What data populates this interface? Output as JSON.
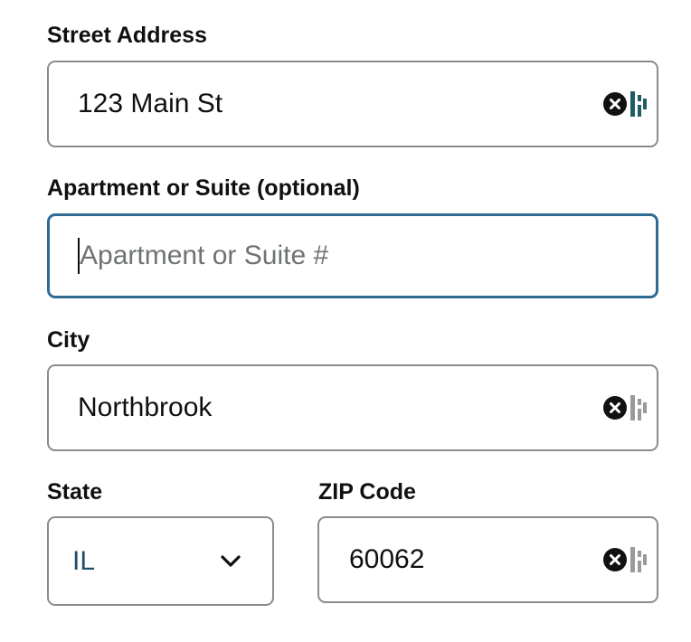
{
  "street": {
    "label": "Street Address",
    "value": "123 Main St",
    "clear_icon": "close-circle-icon",
    "autofill_icon": "password-manager-icon"
  },
  "apartment": {
    "label": "Apartment or Suite (optional)",
    "value": "",
    "placeholder": "Apartment or Suite #"
  },
  "city": {
    "label": "City",
    "value": "Northbrook",
    "clear_icon": "close-circle-icon",
    "autofill_icon": "password-manager-icon"
  },
  "state": {
    "label": "State",
    "selected": "IL",
    "dropdown_icon": "chevron-down-icon"
  },
  "zip": {
    "label": "ZIP Code",
    "value": "60062",
    "clear_icon": "close-circle-icon",
    "autofill_icon": "password-manager-icon"
  },
  "colors": {
    "border": "#888c8c",
    "focus_border": "#2f6c94",
    "text": "#0f1111",
    "placeholder": "#6f7373",
    "select_text": "#1d4e6b",
    "autofill_accent": "#1f5c63"
  }
}
